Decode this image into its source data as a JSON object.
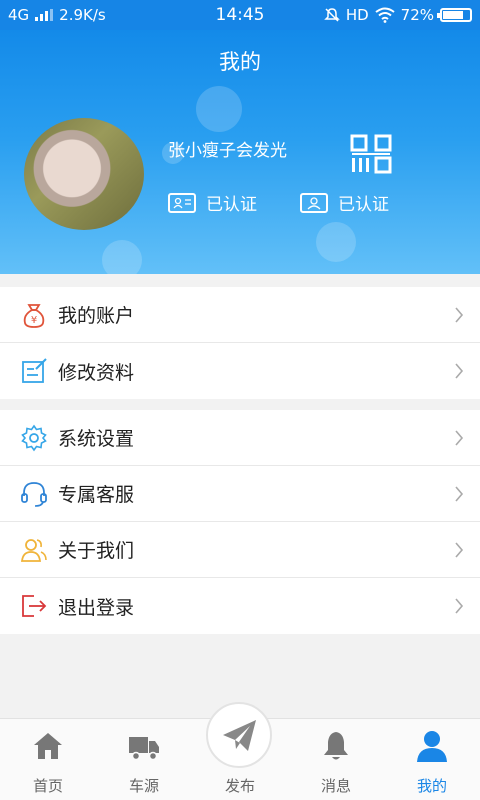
{
  "status_bar": {
    "network": "4G",
    "speed": "2.9K/s",
    "time": "14:45",
    "hd": "HD",
    "battery": "72%"
  },
  "header": {
    "title": "我的",
    "username": "张小瘦子会发光",
    "cert_id_label": "已认证",
    "cert_face_label": "已认证"
  },
  "menu_group_1": [
    {
      "label": "我的账户",
      "icon": "money-bag-icon"
    },
    {
      "label": "修改资料",
      "icon": "edit-icon"
    }
  ],
  "menu_group_2": [
    {
      "label": "系统设置",
      "icon": "gear-icon"
    },
    {
      "label": "专属客服",
      "icon": "headset-icon"
    },
    {
      "label": "关于我们",
      "icon": "users-icon"
    },
    {
      "label": "退出登录",
      "icon": "logout-icon"
    }
  ],
  "bottom_nav": [
    {
      "label": "首页",
      "icon": "home-icon"
    },
    {
      "label": "车源",
      "icon": "truck-icon"
    },
    {
      "label": "发布",
      "icon": "paper-plane-icon"
    },
    {
      "label": "消息",
      "icon": "bell-icon"
    },
    {
      "label": "我的",
      "icon": "user-icon",
      "active": true
    }
  ],
  "colors": {
    "accent": "#1a86e6",
    "header_top": "#138ae9",
    "header_bottom": "#62c0f8"
  }
}
